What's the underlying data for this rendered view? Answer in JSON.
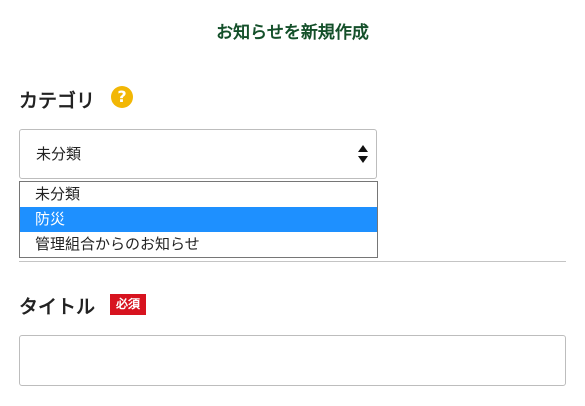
{
  "page": {
    "title": "お知らせを新規作成"
  },
  "category": {
    "label": "カテゴリ",
    "help_icon": "?",
    "selected_value": "未分類",
    "options": [
      "未分類",
      "防災",
      "管理組合からのお知らせ"
    ],
    "highlighted_index": 1
  },
  "title_field": {
    "label": "タイトル",
    "required_badge": "必須",
    "value": "",
    "placeholder": ""
  },
  "colors": {
    "title_green": "#14502a",
    "help_icon_yellow": "#f2b705",
    "required_red": "#d7131f",
    "option_highlight": "#1e90ff",
    "option_highlight_text": "#ffffff"
  },
  "icons": {
    "help": "question-circle-icon",
    "select": "select-arrows-icon"
  }
}
